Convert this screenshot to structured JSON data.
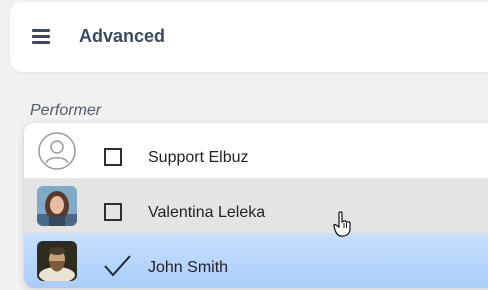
{
  "header": {
    "title": "Advanced",
    "menu_icon": "hamburger-menu-icon"
  },
  "performer": {
    "label": "Performer",
    "options": [
      {
        "name": "Support Elbuz",
        "checked": false,
        "avatar": "default-user-icon"
      },
      {
        "name": "Valentina Leleka",
        "checked": false,
        "avatar": "woman-photo",
        "state": "hover"
      },
      {
        "name": "John Smith",
        "checked": true,
        "avatar": "man-portrait-photo",
        "state": "selected"
      }
    ]
  },
  "colors": {
    "header_text": "#3a4a67",
    "selected_bg": "#b9d7fc",
    "hover_bg": "#e4e4e4"
  }
}
